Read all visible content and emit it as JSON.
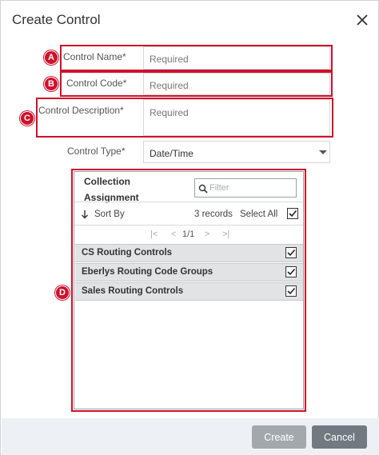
{
  "dialog": {
    "title": "Create Control",
    "close_icon": "close-icon"
  },
  "fields": {
    "control_name": {
      "label": "Control Name*",
      "placeholder": "Required",
      "marker": "A"
    },
    "control_code": {
      "label": "Control Code*",
      "placeholder": "Required",
      "marker": "B"
    },
    "control_description": {
      "label": "Control Description*",
      "placeholder": "Required",
      "marker": "C"
    },
    "control_type": {
      "label": "Control Type*",
      "value": "Date/Time"
    }
  },
  "collection": {
    "marker": "D",
    "title_line1": "Collection",
    "title_line2": "Assignment",
    "filter_placeholder": "Filter",
    "sort_label": "Sort By",
    "records": "3 records",
    "select_all": "Select All",
    "select_all_checked": true,
    "pager": {
      "first": "|<",
      "prev": "<",
      "page": "1/1",
      "next": ">",
      "last": ">|"
    },
    "items": [
      {
        "label": "CS Routing Controls",
        "checked": true
      },
      {
        "label": "Eberlys Routing Code Groups",
        "checked": true
      },
      {
        "label": "Sales Routing Controls",
        "checked": true
      }
    ]
  },
  "footer": {
    "create_label": "Create",
    "cancel_label": "Cancel"
  },
  "colors": {
    "annotation_red": "#d0112b",
    "create_button": "#a3a8ad",
    "cancel_button": "#737980",
    "row_background": "#e2e3e5"
  }
}
